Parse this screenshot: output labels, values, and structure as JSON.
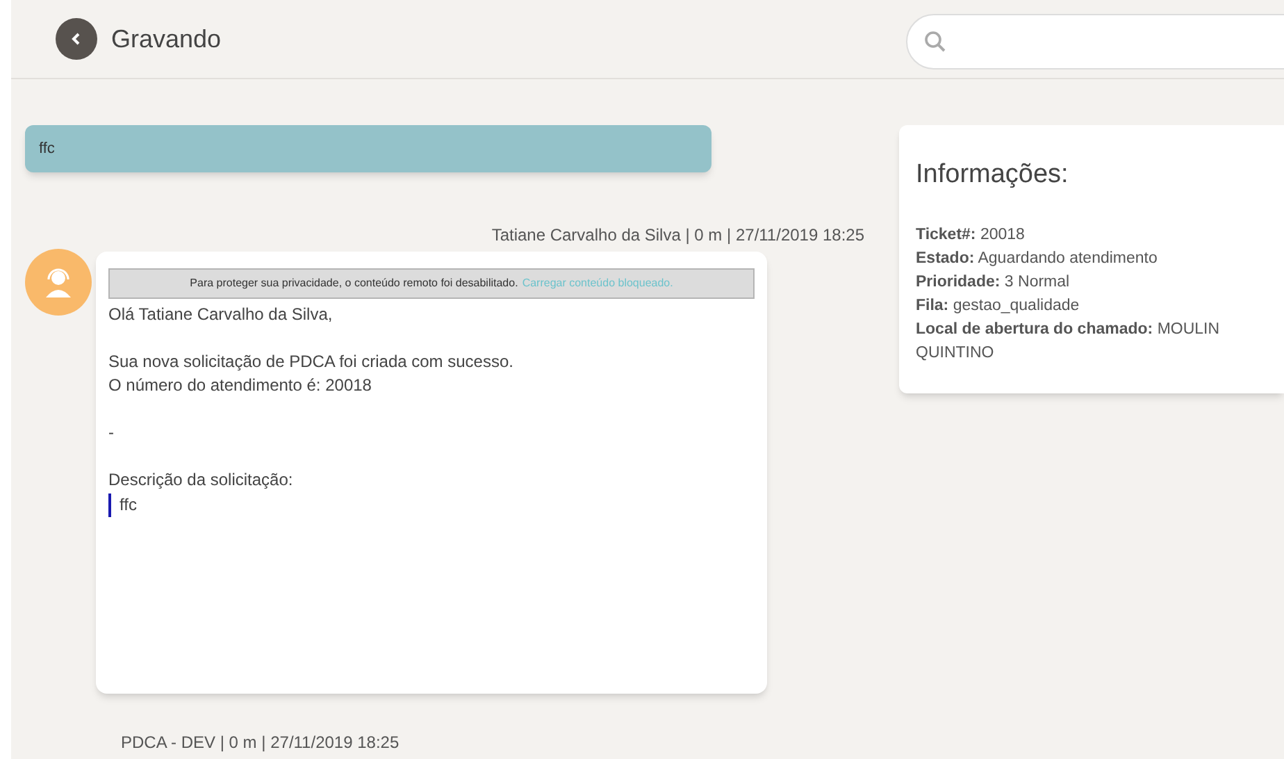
{
  "header": {
    "title": "Gravando"
  },
  "subject_bar": {
    "text": "ffc"
  },
  "message": {
    "meta": "Tatiane Carvalho da Silva | 0 m | 27/11/2019 18:25",
    "privacy_notice": {
      "text": "Para proteger sua privacidade, o conteúdo remoto foi desabilitado.",
      "link": "Carregar conteúdo bloqueado."
    },
    "body": [
      {
        "kind": "line",
        "text": "Olá Tatiane Carvalho da Silva,"
      },
      {
        "kind": "gap"
      },
      {
        "kind": "line",
        "text": "Sua nova solicitação de PDCA foi criada com sucesso."
      },
      {
        "kind": "line",
        "text": "O número do atendimento é: 20018"
      },
      {
        "kind": "gap"
      },
      {
        "kind": "line",
        "text": "-"
      },
      {
        "kind": "gap"
      },
      {
        "kind": "line",
        "text": "Descrição da solicitação:"
      },
      {
        "kind": "quote",
        "text": "ffc"
      }
    ]
  },
  "next_meta": "PDCA - DEV | 0 m | 27/11/2019 18:25",
  "info": {
    "title": "Informações:",
    "fields": [
      {
        "label": "Ticket#:",
        "value": "20018"
      },
      {
        "label": "Estado:",
        "value": "Aguardando atendimento"
      },
      {
        "label": "Prioridade:",
        "value": "3 Normal"
      },
      {
        "label": "Fila:",
        "value": "gestao_qualidade"
      },
      {
        "label": "Local de abertura do chamado:",
        "value": "MOULIN QUINTINO"
      }
    ]
  }
}
